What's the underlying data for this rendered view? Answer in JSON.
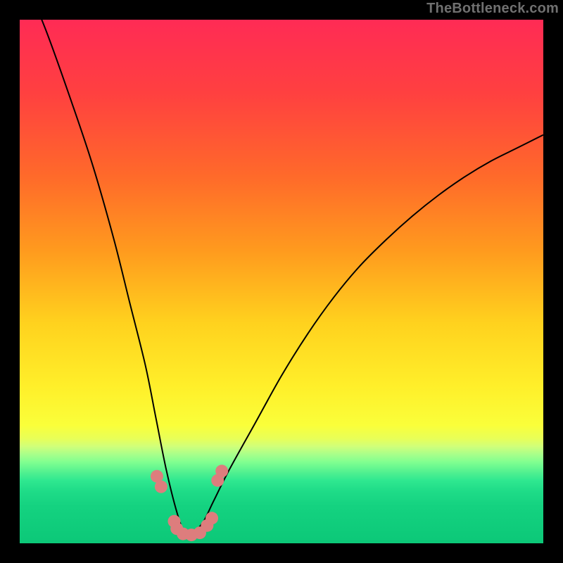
{
  "watermark": "TheBottleneck.com",
  "colors": {
    "curve": "#000000",
    "marker": "#dd7d7d",
    "frame_bg": "#000000"
  },
  "chart_data": {
    "type": "line",
    "title": "",
    "xlabel": "",
    "ylabel": "",
    "xlim": [
      0,
      1
    ],
    "ylim": [
      0,
      1
    ],
    "grid": false,
    "legend": false,
    "series": [
      {
        "name": "bottleneck-curve",
        "x": [
          0.0,
          0.05,
          0.1,
          0.14,
          0.18,
          0.21,
          0.24,
          0.26,
          0.28,
          0.3,
          0.315,
          0.33,
          0.35,
          0.37,
          0.4,
          0.45,
          0.5,
          0.55,
          0.6,
          0.65,
          0.7,
          0.75,
          0.8,
          0.85,
          0.9,
          0.95,
          1.0
        ],
        "y": [
          1.1,
          0.98,
          0.84,
          0.72,
          0.58,
          0.46,
          0.34,
          0.24,
          0.14,
          0.06,
          0.02,
          0.02,
          0.04,
          0.08,
          0.14,
          0.23,
          0.32,
          0.4,
          0.47,
          0.53,
          0.58,
          0.625,
          0.665,
          0.7,
          0.73,
          0.755,
          0.78
        ]
      }
    ],
    "markers": [
      {
        "x": 0.262,
        "y": 0.128
      },
      {
        "x": 0.27,
        "y": 0.108
      },
      {
        "x": 0.295,
        "y": 0.042
      },
      {
        "x": 0.3,
        "y": 0.028
      },
      {
        "x": 0.312,
        "y": 0.018
      },
      {
        "x": 0.328,
        "y": 0.016
      },
      {
        "x": 0.344,
        "y": 0.02
      },
      {
        "x": 0.358,
        "y": 0.034
      },
      {
        "x": 0.367,
        "y": 0.048
      },
      {
        "x": 0.378,
        "y": 0.12
      },
      {
        "x": 0.386,
        "y": 0.138
      }
    ],
    "annotations": []
  }
}
